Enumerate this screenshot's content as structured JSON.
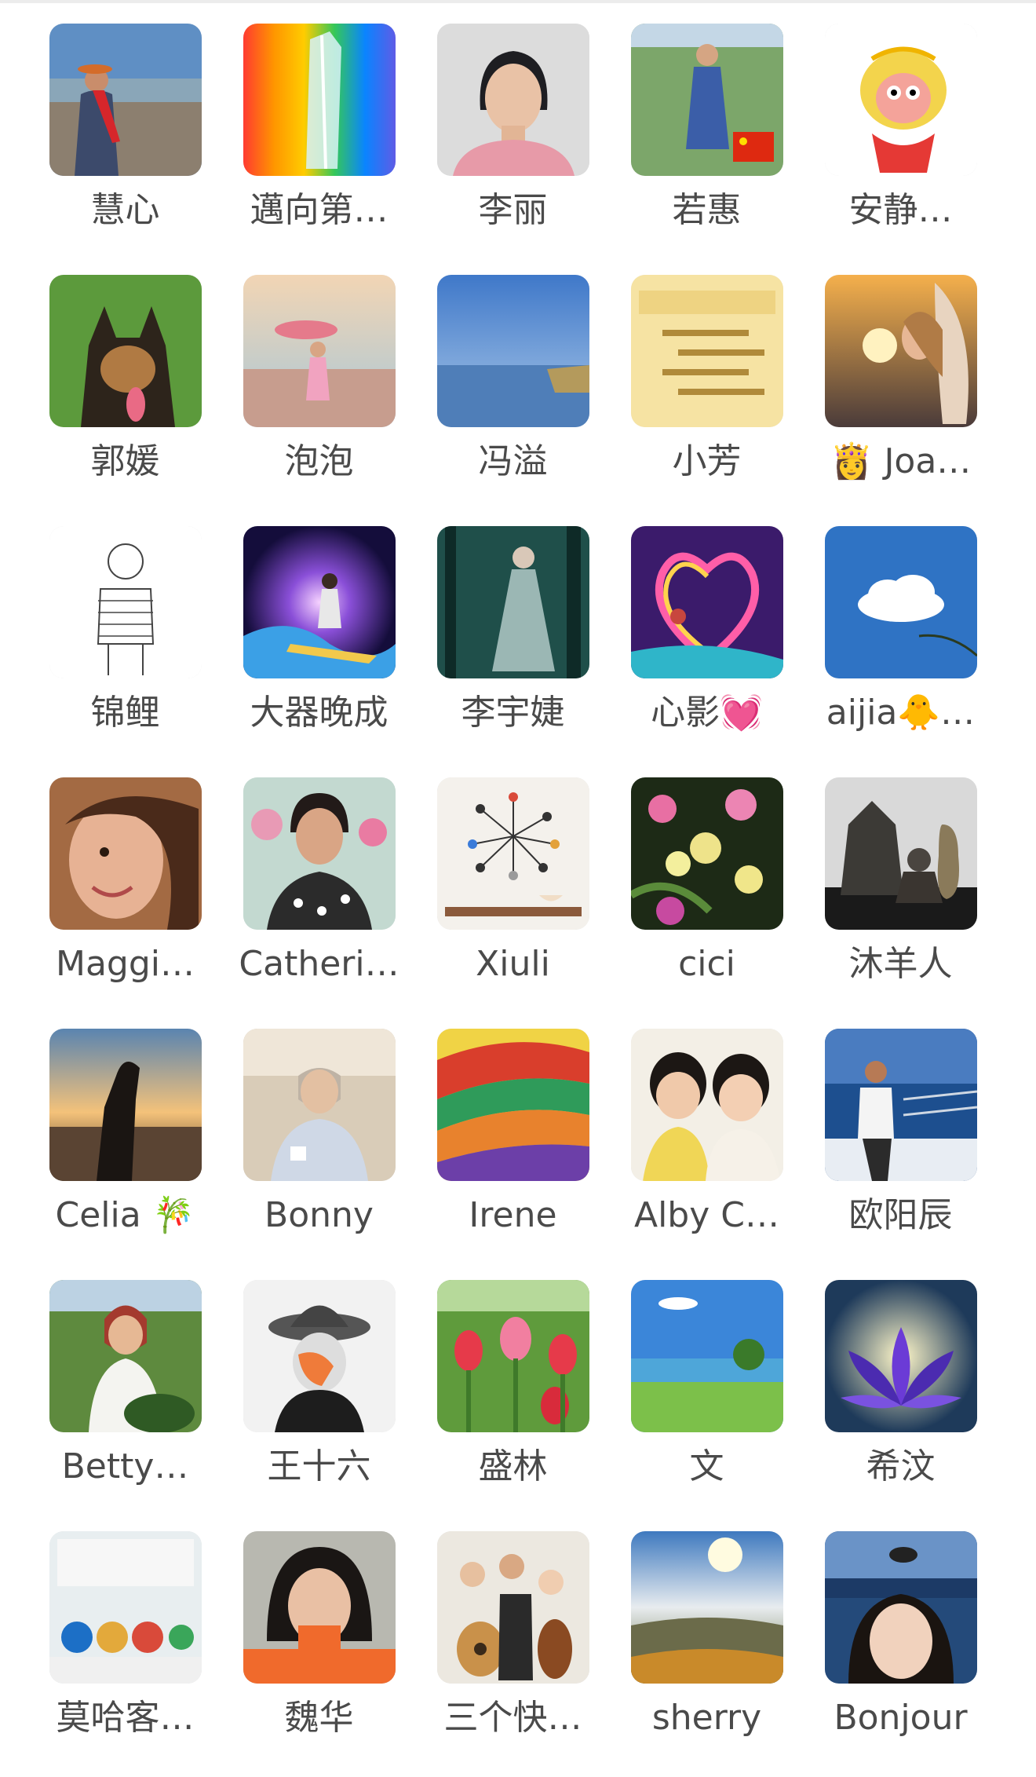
{
  "members": [
    {
      "name": "慧心",
      "avatar_icon": "woman-at-lakeshore-photo"
    },
    {
      "name": "邁向第…",
      "avatar_icon": "rainbow-crystal-photo"
    },
    {
      "name": "李丽",
      "avatar_icon": "woman-portrait-photo"
    },
    {
      "name": "若惠",
      "avatar_icon": "woman-in-dress-photo"
    },
    {
      "name": "安静…",
      "avatar_icon": "monkey-king-cartoon"
    },
    {
      "name": "郭媛",
      "avatar_icon": "german-shepherd-photo"
    },
    {
      "name": "泡泡",
      "avatar_icon": "woman-with-parasol-photo"
    },
    {
      "name": "冯溢",
      "avatar_icon": "lake-landscape-photo"
    },
    {
      "name": "小芳",
      "avatar_icon": "gratitude-text-card"
    },
    {
      "name": "👸 Joa…",
      "avatar_icon": "angel-woman-sunset"
    },
    {
      "name": "锦鲤",
      "avatar_icon": "sketch-figure-drawing"
    },
    {
      "name": "大器晚成",
      "avatar_icon": "surfer-galaxy-art"
    },
    {
      "name": "李宇婕",
      "avatar_icon": "forest-fairy-art"
    },
    {
      "name": "心影💓",
      "avatar_icon": "rainbow-heart-art"
    },
    {
      "name": "aijia🐥…",
      "avatar_icon": "cloud-sky-photo"
    },
    {
      "name": "Maggi…",
      "avatar_icon": "smiling-girl-photo"
    },
    {
      "name": "Catheri…",
      "avatar_icon": "woman-with-flowers-photo"
    },
    {
      "name": "Xiuli",
      "avatar_icon": "wall-clock-photo"
    },
    {
      "name": "cici",
      "avatar_icon": "orchid-flowers-photo"
    },
    {
      "name": "沐羊人",
      "avatar_icon": "stone-sculpture-photo"
    },
    {
      "name": "Celia 🎋",
      "avatar_icon": "dog-silhouette-sunset"
    },
    {
      "name": "Bonny",
      "avatar_icon": "elderly-woman-photo"
    },
    {
      "name": "Irene",
      "avatar_icon": "colorful-fields-painting"
    },
    {
      "name": "Alby C…",
      "avatar_icon": "two-children-photo"
    },
    {
      "name": "欧阳辰",
      "avatar_icon": "man-on-boat-photo"
    },
    {
      "name": "Betty…",
      "avatar_icon": "woman-in-garden-photo"
    },
    {
      "name": "王十六",
      "avatar_icon": "hat-figure-art"
    },
    {
      "name": "盛林",
      "avatar_icon": "tulips-photo"
    },
    {
      "name": "文",
      "avatar_icon": "green-meadow-lake"
    },
    {
      "name": "希汶",
      "avatar_icon": "purple-lotus-art"
    },
    {
      "name": "莫哈客…",
      "avatar_icon": "glocal-infographic"
    },
    {
      "name": "魏华",
      "avatar_icon": "woman-selfie-badge"
    },
    {
      "name": "三个快…",
      "avatar_icon": "three-kids-instruments"
    },
    {
      "name": "sherry",
      "avatar_icon": "hill-sunset-photo"
    },
    {
      "name": "Bonjour",
      "avatar_icon": "woman-beach-photo"
    }
  ]
}
